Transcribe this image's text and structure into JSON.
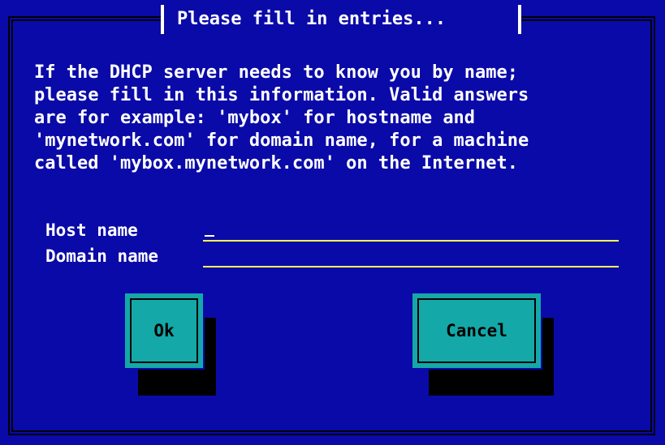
{
  "dialog": {
    "title": "Please fill in entries...",
    "message": "If the DHCP server needs to know you by name;\nplease fill in this information. Valid answers\nare for example: 'mybox' for hostname and\n'mynetwork.com' for domain name, for a machine\ncalled 'mybox.mynetwork.com' on the Internet.",
    "fields": [
      {
        "label": "Host name",
        "value": ""
      },
      {
        "label": "Domain name",
        "value": ""
      }
    ],
    "buttons": {
      "ok": "Ok",
      "cancel": "Cancel"
    }
  },
  "colors": {
    "background": "#0A0AA8",
    "button": "#14A8A8",
    "field_underline": "#FFFF55",
    "text": "#FFFFFF"
  }
}
